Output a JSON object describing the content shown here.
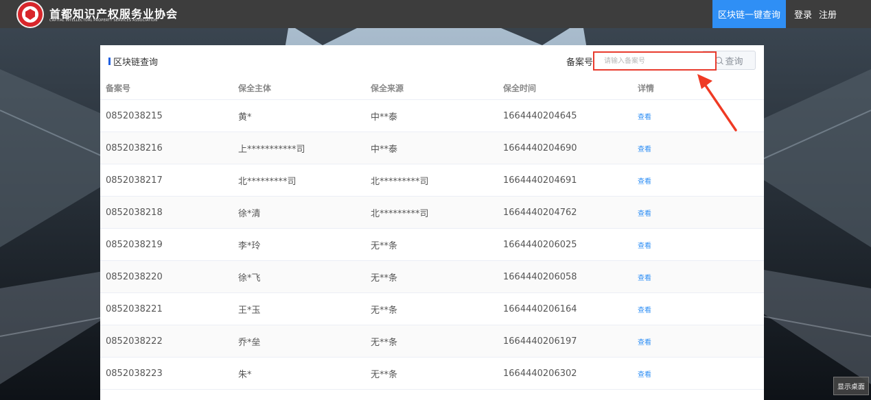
{
  "header": {
    "brand_cn": "首都知识产权服务业协会",
    "brand_en": "CAPITAL INTELLECTUAL PROPERTY SERVICES ASSOCIATION",
    "nav_chain": "区块链一键查询",
    "login": "登录",
    "register": "注册",
    "accent": "#2f8ff5"
  },
  "panel": {
    "title": "区块链查询",
    "search_label": "备案号",
    "search_placeholder": "请输入备案号",
    "search_button": "查询",
    "highlight_color": "#e83a2c"
  },
  "table": {
    "columns": [
      "备案号",
      "保全主体",
      "保全来源",
      "保全时间",
      "详情"
    ],
    "rows": [
      {
        "id": "0852038215",
        "subject": "黄*",
        "source": "中**泰",
        "time": "1664440204645",
        "detail": "查看"
      },
      {
        "id": "0852038216",
        "subject": "上***********司",
        "source": "中**泰",
        "time": "1664440204690",
        "detail": "查看"
      },
      {
        "id": "0852038217",
        "subject": "北*********司",
        "source": "北*********司",
        "time": "1664440204691",
        "detail": "查看"
      },
      {
        "id": "0852038218",
        "subject": "徐*清",
        "source": "北*********司",
        "time": "1664440204762",
        "detail": "查看"
      },
      {
        "id": "0852038219",
        "subject": "李*玲",
        "source": "无**条",
        "time": "1664440206025",
        "detail": "查看"
      },
      {
        "id": "0852038220",
        "subject": "徐*飞",
        "source": "无**条",
        "time": "1664440206058",
        "detail": "查看"
      },
      {
        "id": "0852038221",
        "subject": "王*玉",
        "source": "无**条",
        "time": "1664440206164",
        "detail": "查看"
      },
      {
        "id": "0852038222",
        "subject": "乔*垒",
        "source": "无**条",
        "time": "1664440206197",
        "detail": "查看"
      },
      {
        "id": "0852038223",
        "subject": "朱*",
        "source": "无**条",
        "time": "1664440206302",
        "detail": "查看"
      }
    ]
  },
  "taskbar": {
    "show_desktop": "显示桌面"
  }
}
